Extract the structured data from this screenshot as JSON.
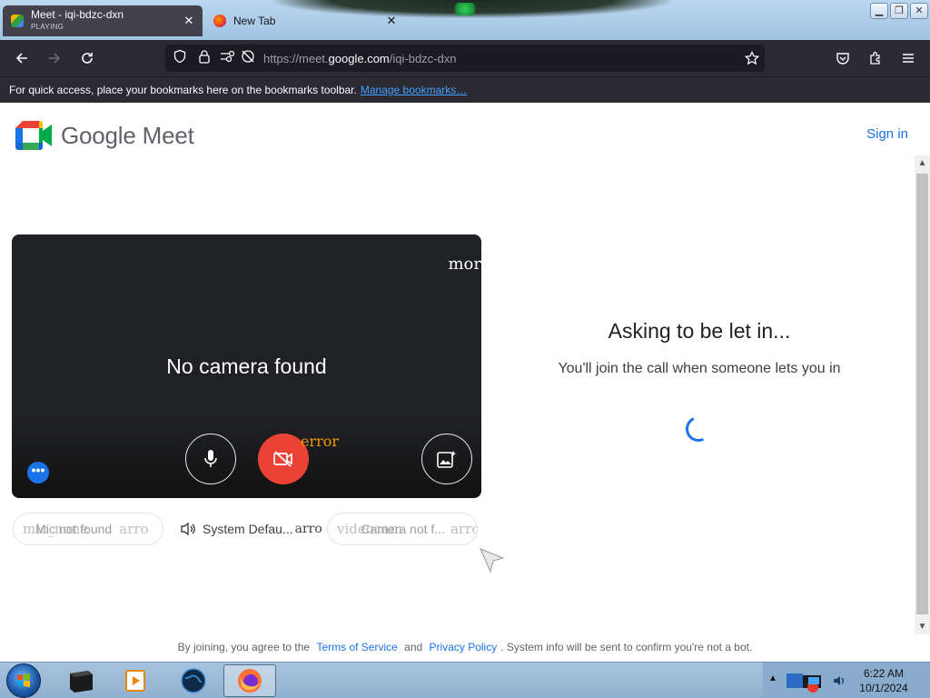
{
  "browser": {
    "tabs": [
      {
        "title": "Meet - iqi-bdzc-dxn",
        "subtitle": "PLAYING",
        "active": true
      },
      {
        "title": "New Tab",
        "active": false
      }
    ],
    "url": {
      "prefix": "https://meet.",
      "domain": "google.com",
      "path": "/iqi-bdzc-dxn"
    },
    "bookmarks_bar": {
      "text": "For quick access, place your bookmarks here on the bookmarks toolbar.",
      "link": "Manage bookmarks…"
    }
  },
  "meet": {
    "brand": "Google Meet",
    "sign_in": "Sign in",
    "preview": {
      "no_camera": "No camera found",
      "more_label": "mor",
      "error_label": "error"
    },
    "devices": {
      "mic": {
        "icon_text": "mic_none",
        "label": "Mic not found",
        "arrow": "arro"
      },
      "speaker": {
        "label": "System Defau...",
        "arrow": "arro"
      },
      "camera": {
        "icon_text": "videocam",
        "label": "Camera not f...",
        "arrow": "arro"
      }
    },
    "status": {
      "heading": "Asking to be let in...",
      "message": "You'll join the call when someone lets you in"
    },
    "footer": {
      "prefix": "By joining, you agree to the",
      "terms": "Terms of Service",
      "and": "and",
      "privacy": "Privacy Policy",
      "suffix": ". System info will be sent to confirm you're not a bot."
    },
    "colors": {
      "accent": "#1a73e8",
      "camera_off": "#ea4335",
      "preview_bg": "#202124"
    }
  },
  "taskbar": {
    "apps": [
      "terminal-icon",
      "media-player-icon",
      "globe-icon",
      "firefox-icon"
    ],
    "time": "6:22 AM",
    "date": "10/1/2024"
  }
}
